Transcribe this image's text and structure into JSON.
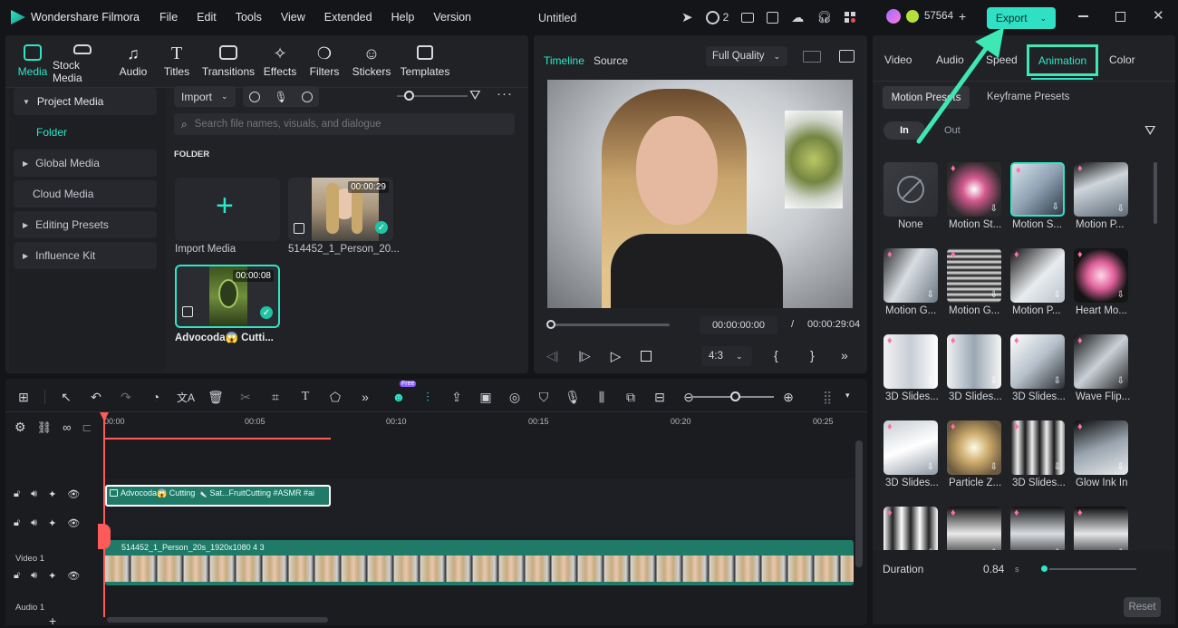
{
  "app": {
    "name": "Wondershare Filmora",
    "doc_title": "Untitled",
    "collab_count": "2",
    "credits": "57564"
  },
  "menu": [
    "File",
    "Edit",
    "Tools",
    "View",
    "Extended",
    "Help",
    "Version"
  ],
  "export_label": "Export",
  "tool_tabs": [
    "Media",
    "Stock Media",
    "Audio",
    "Titles",
    "Transitions",
    "Effects",
    "Filters",
    "Stickers",
    "Templates"
  ],
  "sidebar": {
    "project_media": "Project Media",
    "folder": "Folder",
    "global_media": "Global Media",
    "cloud_media": "Cloud Media",
    "editing_presets": "Editing Presets",
    "influence_kit": "Influence Kit"
  },
  "media": {
    "import_label": "Import",
    "search_placeholder": "Search file names, visuals, and dialogue",
    "folder_heading": "FOLDER",
    "import_media_label": "Import Media",
    "items": [
      {
        "name": "514452_1_Person_20...",
        "duration": "00:00:29"
      },
      {
        "name": "Advocoda😱 Cutti...",
        "duration": "00:00:08"
      }
    ]
  },
  "preview": {
    "tab_timeline": "Timeline",
    "tab_source": "Source",
    "quality": "Full Quality",
    "current_time": "00:00:00:00",
    "separator": "/",
    "total_time": "00:00:29:04",
    "aspect": "4:3"
  },
  "right_panel": {
    "tabs": [
      "Video",
      "Audio",
      "Speed",
      "Animation",
      "Color"
    ],
    "active_tab": "Animation",
    "sub_tabs": [
      "Motion Presets",
      "Keyframe Presets"
    ],
    "in_label": "In",
    "out_label": "Out",
    "presets": [
      "None",
      "Motion St...",
      "Motion S...",
      "Motion P...",
      "Motion G...",
      "Motion G...",
      "Motion P...",
      "Heart Mo...",
      "3D Slides...",
      "3D Slides...",
      "3D Slides...",
      "Wave Flip...",
      "3D Slides...",
      "Particle Z...",
      "3D Slides...",
      "Glow Ink In",
      "",
      "",
      "",
      ""
    ],
    "duration_label": "Duration",
    "duration_value": "0.84",
    "duration_unit": "s",
    "reset_label": "Reset"
  },
  "timeline": {
    "ruler": [
      "00:00",
      "00:05",
      "00:10",
      "00:15",
      "00:20",
      "00:25"
    ],
    "clip_overlay": "Advocoda😱 Cutting 🔪 Sat...FruitCutting #ASMR #ai",
    "clip_main": "514452_1_Person_20s_1920x1080 4 3",
    "track_video1": "Video 1",
    "track_audio1": "Audio 1",
    "free_badge": "Free"
  },
  "colors": {
    "accent": "#2ee6c7",
    "export_bg": "#2fe0c4",
    "clip_green": "#1f7a68",
    "playhead": "#ff5a5a",
    "annotation_arrow": "#3ee8b5"
  }
}
